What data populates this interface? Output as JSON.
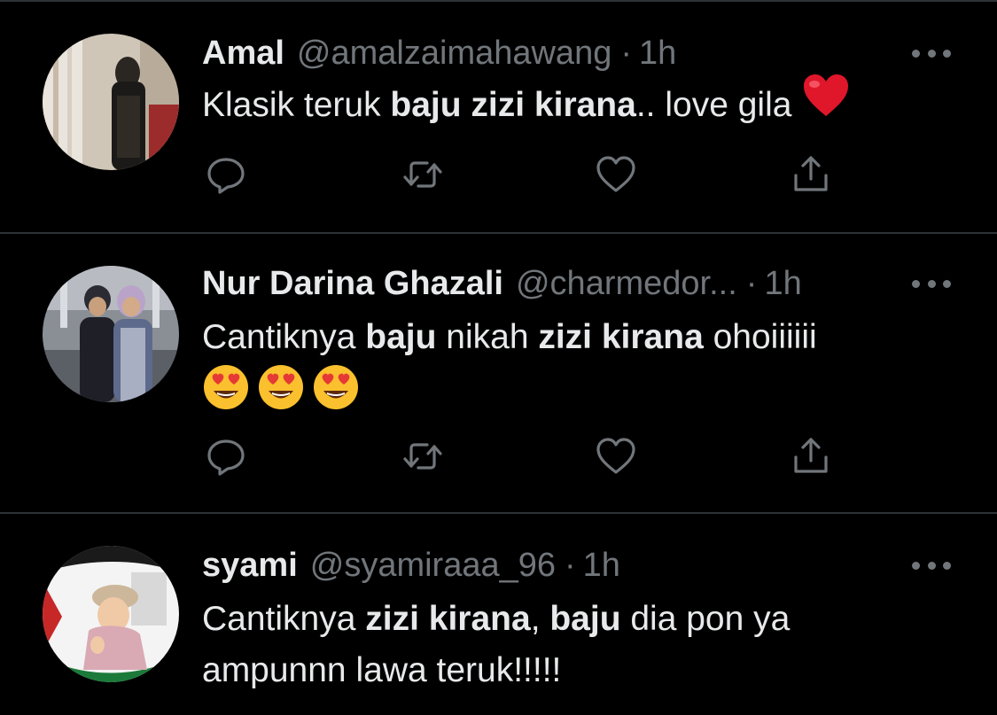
{
  "colors": {
    "background": "#000000",
    "text_primary": "#e7e9ea",
    "text_secondary": "#71767b",
    "divider": "#2f3336",
    "heart_red": "#e0162b"
  },
  "tweets": [
    {
      "name": "Amal",
      "handle": "@amalzaimahawang",
      "dot": "·",
      "time": "1h",
      "text_parts": [
        "Klasik teruk ",
        "baju zizi kirana",
        ".. love gila"
      ],
      "emoji": "red-heart"
    },
    {
      "name": "Nur Darina Ghazali",
      "handle": "@charmedor...",
      "dot": "·",
      "time": "1h",
      "text_parts": [
        "Cantiknya ",
        "baju",
        " nikah ",
        "zizi kirana",
        " ohoiiiiii"
      ],
      "emoji": "heart-eyes x3"
    },
    {
      "name": "syami",
      "handle": "@syamiraaa_96",
      "dot": "·",
      "time": "1h",
      "text_parts": [
        "Cantiknya ",
        "zizi kirana",
        ", ",
        "baju",
        " dia pon ya",
        "ampunnn lawa teruk!!!!!"
      ]
    }
  ],
  "action_icons": [
    "reply-icon",
    "retweet-icon",
    "like-icon",
    "share-icon"
  ]
}
